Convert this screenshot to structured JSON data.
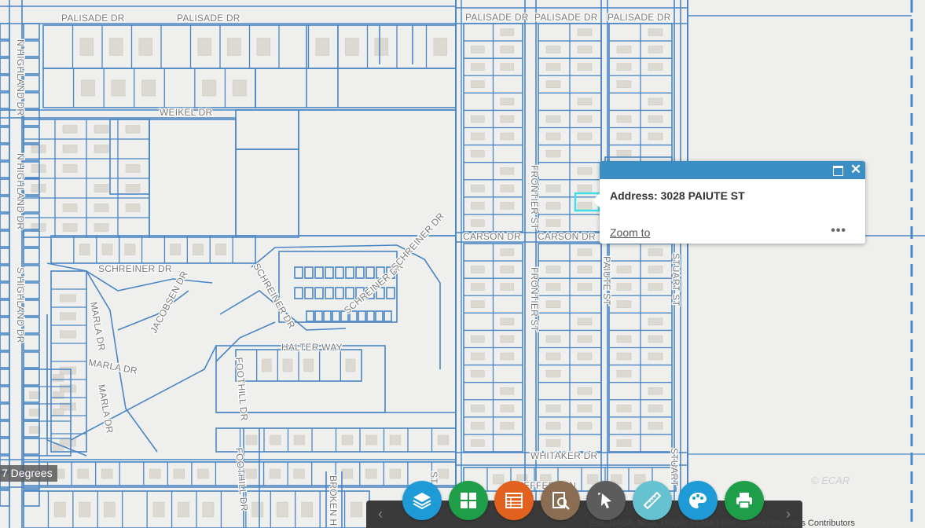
{
  "map": {
    "background": "#efefed",
    "parcel_color": "#4a86c5",
    "building_color": "#d9d6cf",
    "streets": [
      {
        "label": "PALISADE DR"
      },
      {
        "label": "PALISADE DR"
      },
      {
        "label": "PALISADE DR"
      },
      {
        "label": "PALISADE DR"
      },
      {
        "label": "PALISADE DR"
      },
      {
        "label": "N HIGHLAND DR"
      },
      {
        "label": "N HIGHLAND DR"
      },
      {
        "label": "S HIGHLAND DR"
      },
      {
        "label": "WEIKEL DR"
      },
      {
        "label": "SCHREINER DR"
      },
      {
        "label": "SCHREINER DR"
      },
      {
        "label": "SCHREINER DR"
      },
      {
        "label": "SCHREINER DR"
      },
      {
        "label": "JACOBSEN DR"
      },
      {
        "label": "MARLA DR"
      },
      {
        "label": "MARLA DR"
      },
      {
        "label": "MARLA DR"
      },
      {
        "label": "HALTER WAY"
      },
      {
        "label": "FOOTHILL DR"
      },
      {
        "label": "FOOTHILL DR"
      },
      {
        "label": "CARSON DR"
      },
      {
        "label": "CARSON DR"
      },
      {
        "label": "FRONTIER ST"
      },
      {
        "label": "FRONTIER ST"
      },
      {
        "label": "PAIUTE ST"
      },
      {
        "label": "STUART ST"
      },
      {
        "label": "STUART"
      },
      {
        "label": "WHITAKER DR"
      },
      {
        "label": "BROKEN H"
      },
      {
        "label": "JEFFERSON"
      },
      {
        "label": "ST"
      }
    ]
  },
  "popup": {
    "address_label": "Address:",
    "address_value": "3028 PAIUTE ST",
    "zoom_label": "Zoom to",
    "more_label": "•••",
    "header_color": "#3b8ec4"
  },
  "rotation_label": "7 Degrees",
  "toolbar": {
    "tools": [
      {
        "name": "layers-icon",
        "color": "#1e9ad6"
      },
      {
        "name": "basemap-gallery-icon",
        "color": "#1f9e4a"
      },
      {
        "name": "attribute-table-icon",
        "color": "#e2611e"
      },
      {
        "name": "search-query-icon",
        "color": "#8a6d52"
      },
      {
        "name": "select-icon",
        "color": "#5c5c5c"
      },
      {
        "name": "measure-icon",
        "color": "#66c2d0"
      },
      {
        "name": "draw-palette-icon",
        "color": "#1e9ad6"
      },
      {
        "name": "print-icon",
        "color": "#1f9e4a"
      }
    ]
  },
  "attribution": "Esri, NASA, NGA, USGS, FEMA | Esri Community Maps Contributors",
  "watermark": "© ECAR"
}
